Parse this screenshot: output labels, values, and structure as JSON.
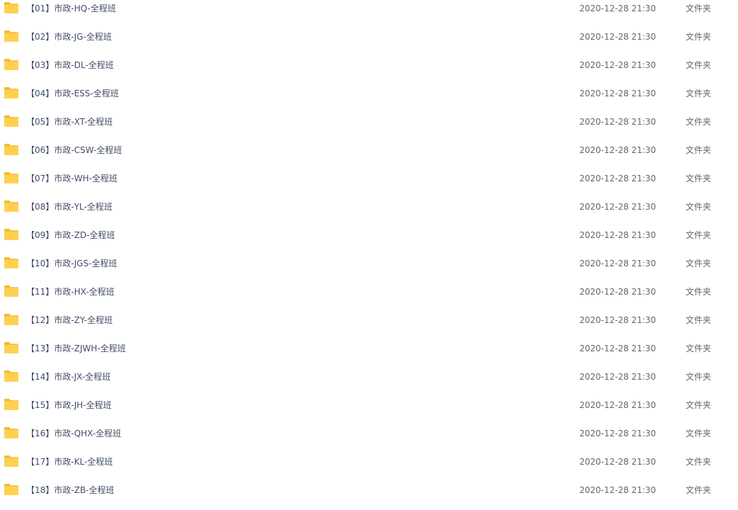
{
  "colors": {
    "folder_body": "#ffd050",
    "folder_tab": "#f5b92e",
    "text": "#424e67",
    "meta_text": "#666666"
  },
  "files": [
    {
      "name": "【01】市政-HQ-全程班",
      "date": "2020-12-28 21:30",
      "type": "文件夹",
      "icon": "folder-icon"
    },
    {
      "name": "【02】市政-JG-全程班",
      "date": "2020-12-28 21:30",
      "type": "文件夹",
      "icon": "folder-icon"
    },
    {
      "name": "【03】市政-DL-全程班",
      "date": "2020-12-28 21:30",
      "type": "文件夹",
      "icon": "folder-icon"
    },
    {
      "name": "【04】市政-ESS-全程班",
      "date": "2020-12-28 21:30",
      "type": "文件夹",
      "icon": "folder-icon"
    },
    {
      "name": "【05】市政-XT-全程班",
      "date": "2020-12-28 21:30",
      "type": "文件夹",
      "icon": "folder-icon"
    },
    {
      "name": "【06】市政-CSW-全程班",
      "date": "2020-12-28 21:30",
      "type": "文件夹",
      "icon": "folder-icon"
    },
    {
      "name": "【07】市政-WH-全程班",
      "date": "2020-12-28 21:30",
      "type": "文件夹",
      "icon": "folder-icon"
    },
    {
      "name": "【08】市政-YL-全程班",
      "date": "2020-12-28 21:30",
      "type": "文件夹",
      "icon": "folder-icon"
    },
    {
      "name": "【09】市政-ZD-全程班",
      "date": "2020-12-28 21:30",
      "type": "文件夹",
      "icon": "folder-icon"
    },
    {
      "name": "【10】市政-JGS-全程班",
      "date": "2020-12-28 21:30",
      "type": "文件夹",
      "icon": "folder-icon"
    },
    {
      "name": "【11】市政-HX-全程班",
      "date": "2020-12-28 21:30",
      "type": "文件夹",
      "icon": "folder-icon"
    },
    {
      "name": "【12】市政-ZY-全程班",
      "date": "2020-12-28 21:30",
      "type": "文件夹",
      "icon": "folder-icon"
    },
    {
      "name": "【13】市政-ZJWH-全程班",
      "date": "2020-12-28 21:30",
      "type": "文件夹",
      "icon": "folder-icon"
    },
    {
      "name": "【14】市政-JX-全程班",
      "date": "2020-12-28 21:30",
      "type": "文件夹",
      "icon": "folder-icon"
    },
    {
      "name": "【15】市政-JH-全程班",
      "date": "2020-12-28 21:30",
      "type": "文件夹",
      "icon": "folder-icon"
    },
    {
      "name": "【16】市政-QHX-全程班",
      "date": "2020-12-28 21:30",
      "type": "文件夹",
      "icon": "folder-icon"
    },
    {
      "name": "【17】市政-KL-全程班",
      "date": "2020-12-28 21:30",
      "type": "文件夹",
      "icon": "folder-icon"
    },
    {
      "name": "【18】市政-ZB-全程班",
      "date": "2020-12-28 21:30",
      "type": "文件夹",
      "icon": "folder-icon"
    }
  ]
}
